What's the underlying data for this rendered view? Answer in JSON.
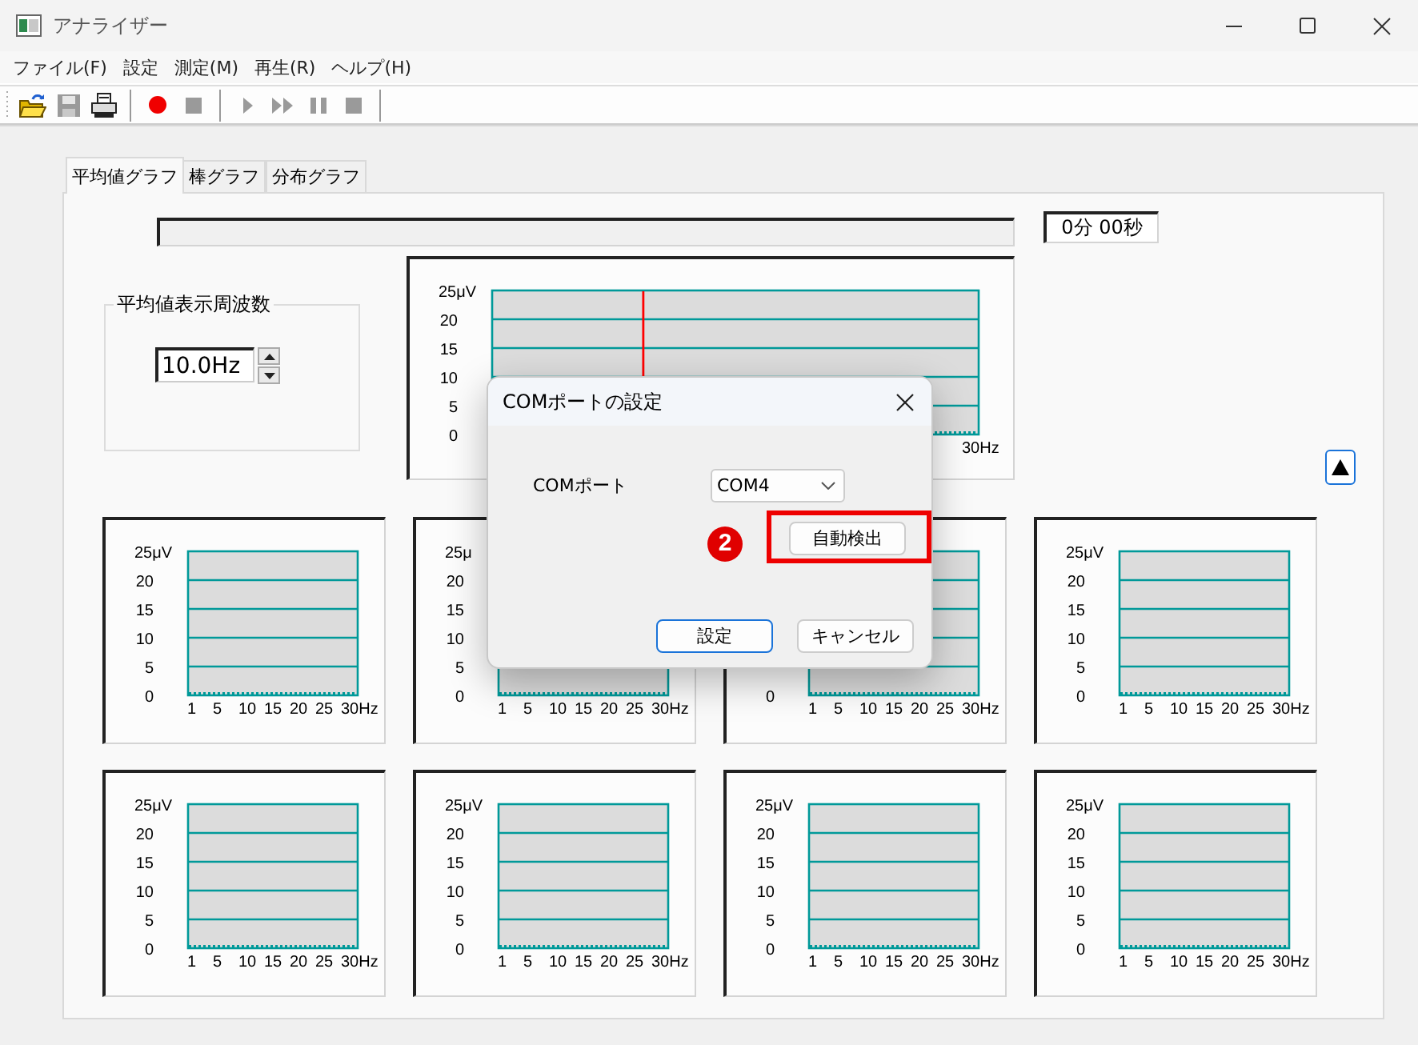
{
  "window": {
    "title": "アナライザー"
  },
  "menu": [
    "ファイル(F)",
    "設定",
    "測定(M)",
    "再生(R)",
    "ヘルプ(H)"
  ],
  "toolbar": [
    {
      "kind": "open",
      "disabled": false
    },
    {
      "kind": "save",
      "disabled": true
    },
    {
      "kind": "print",
      "disabled": false
    },
    {
      "kind": "separator"
    },
    {
      "kind": "record",
      "disabled": false
    },
    {
      "kind": "stop",
      "disabled": true
    },
    {
      "kind": "separator"
    },
    {
      "kind": "play",
      "disabled": true
    },
    {
      "kind": "fast_forward",
      "disabled": true
    },
    {
      "kind": "pause",
      "disabled": true
    },
    {
      "kind": "stop",
      "disabled": true
    },
    {
      "kind": "separator"
    }
  ],
  "tabs": [
    {
      "label": "平均値グラフ",
      "selected": true
    },
    {
      "label": "棒グラフ",
      "selected": false
    },
    {
      "label": "分布グラフ",
      "selected": false
    }
  ],
  "elapsed": "0分 00秒",
  "frequency_group": {
    "title": "平均値表示周波数",
    "value": "10.0Hz"
  },
  "main_graph": {
    "y_labels": [
      "25μV",
      "20",
      "15",
      "10",
      "5",
      "0"
    ],
    "x_labels": [
      "30Hz"
    ],
    "cursor": {
      "level": 0.31
    }
  },
  "graphs": [
    {
      "y_labels": [
        "25μV",
        "20",
        "15",
        "10",
        "5",
        "0"
      ],
      "x_labels": [
        "1",
        "5",
        "10",
        "15",
        "20",
        "25",
        "30Hz"
      ]
    },
    {
      "y_labels": [
        "25μ",
        "20",
        "15",
        "10",
        "5",
        "0"
      ],
      "x_labels": [
        "1",
        "5",
        "10",
        "15",
        "20",
        "25",
        "30Hz"
      ]
    },
    {
      "y_labels": [
        "0"
      ],
      "x_labels": [
        "1",
        "5",
        "10",
        "15",
        "20",
        "25",
        "30Hz"
      ]
    },
    {
      "y_labels": [
        "25μV",
        "20",
        "15",
        "10",
        "5",
        "0"
      ],
      "x_labels": [
        "1",
        "5",
        "10",
        "15",
        "20",
        "25",
        "30Hz"
      ]
    },
    {
      "y_labels": [
        "25μV",
        "20",
        "15",
        "10",
        "5",
        "0"
      ],
      "x_labels": [
        "1",
        "5",
        "10",
        "15",
        "20",
        "25",
        "30Hz"
      ]
    },
    {
      "y_labels": [
        "25μV",
        "20",
        "15",
        "10",
        "5",
        "0"
      ],
      "x_labels": [
        "1",
        "5",
        "10",
        "15",
        "20",
        "25",
        "30Hz"
      ]
    },
    {
      "y_labels": [
        "25μV",
        "20",
        "15",
        "10",
        "5",
        "0"
      ],
      "x_labels": [
        "1",
        "5",
        "10",
        "15",
        "20",
        "25",
        "30Hz"
      ]
    },
    {
      "y_labels": [
        "25μV",
        "20",
        "15",
        "10",
        "5",
        "0"
      ],
      "x_labels": [
        "1",
        "5",
        "10",
        "15",
        "20",
        "25",
        "30Hz"
      ]
    }
  ],
  "dialog": {
    "title": "COMポートの設定",
    "port_label": "COMポート",
    "port_value": "COM4",
    "auto_detect": "自動検出",
    "buttons": [
      {
        "label": "設定",
        "default": true
      },
      {
        "label": "キャンセル",
        "default": false
      }
    ],
    "step_badge": "2"
  }
}
